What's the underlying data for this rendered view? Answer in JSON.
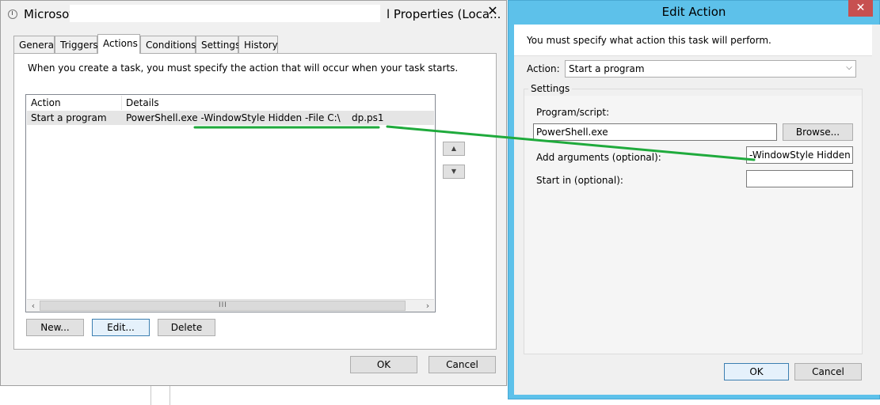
{
  "props_window": {
    "title_start": "Microsof",
    "title_end": "l Properties (Loca...",
    "close_symbol": "✕",
    "tabs": [
      "General",
      "Triggers",
      "Actions",
      "Conditions",
      "Settings",
      "History"
    ],
    "active_tab": "Actions",
    "intro": "When you create a task, you must specify the action that will occur when your task starts.",
    "columns": [
      "Action",
      "Details"
    ],
    "rows": [
      {
        "action": "Start a program",
        "details_a": "PowerShell.exe -WindowStyle Hidden -File C:\\",
        "details_b": "dp.ps1"
      }
    ],
    "buttons": {
      "new": "New...",
      "edit": "Edit...",
      "delete": "Delete",
      "ok": "OK",
      "cancel": "Cancel"
    },
    "scroll_grip": "III"
  },
  "edit_action": {
    "title": "Edit Action",
    "close_symbol": "✕",
    "prompt": "You must specify what action this task will perform.",
    "action_label": "Action:",
    "action_value": "Start a program",
    "settings_label": "Settings",
    "program_label": "Program/script:",
    "program_value": "PowerShell.exe",
    "browse": "Browse...",
    "args_label": "Add arguments (optional):",
    "args_value": "-WindowStyle Hidden -F",
    "startin_label": "Start in (optional):",
    "startin_value": "",
    "ok": "OK",
    "cancel": "Cancel"
  },
  "colors": {
    "annotation": "#1faa3c",
    "dialog_frame": "#5dc1ea",
    "close_red": "#c75050"
  }
}
